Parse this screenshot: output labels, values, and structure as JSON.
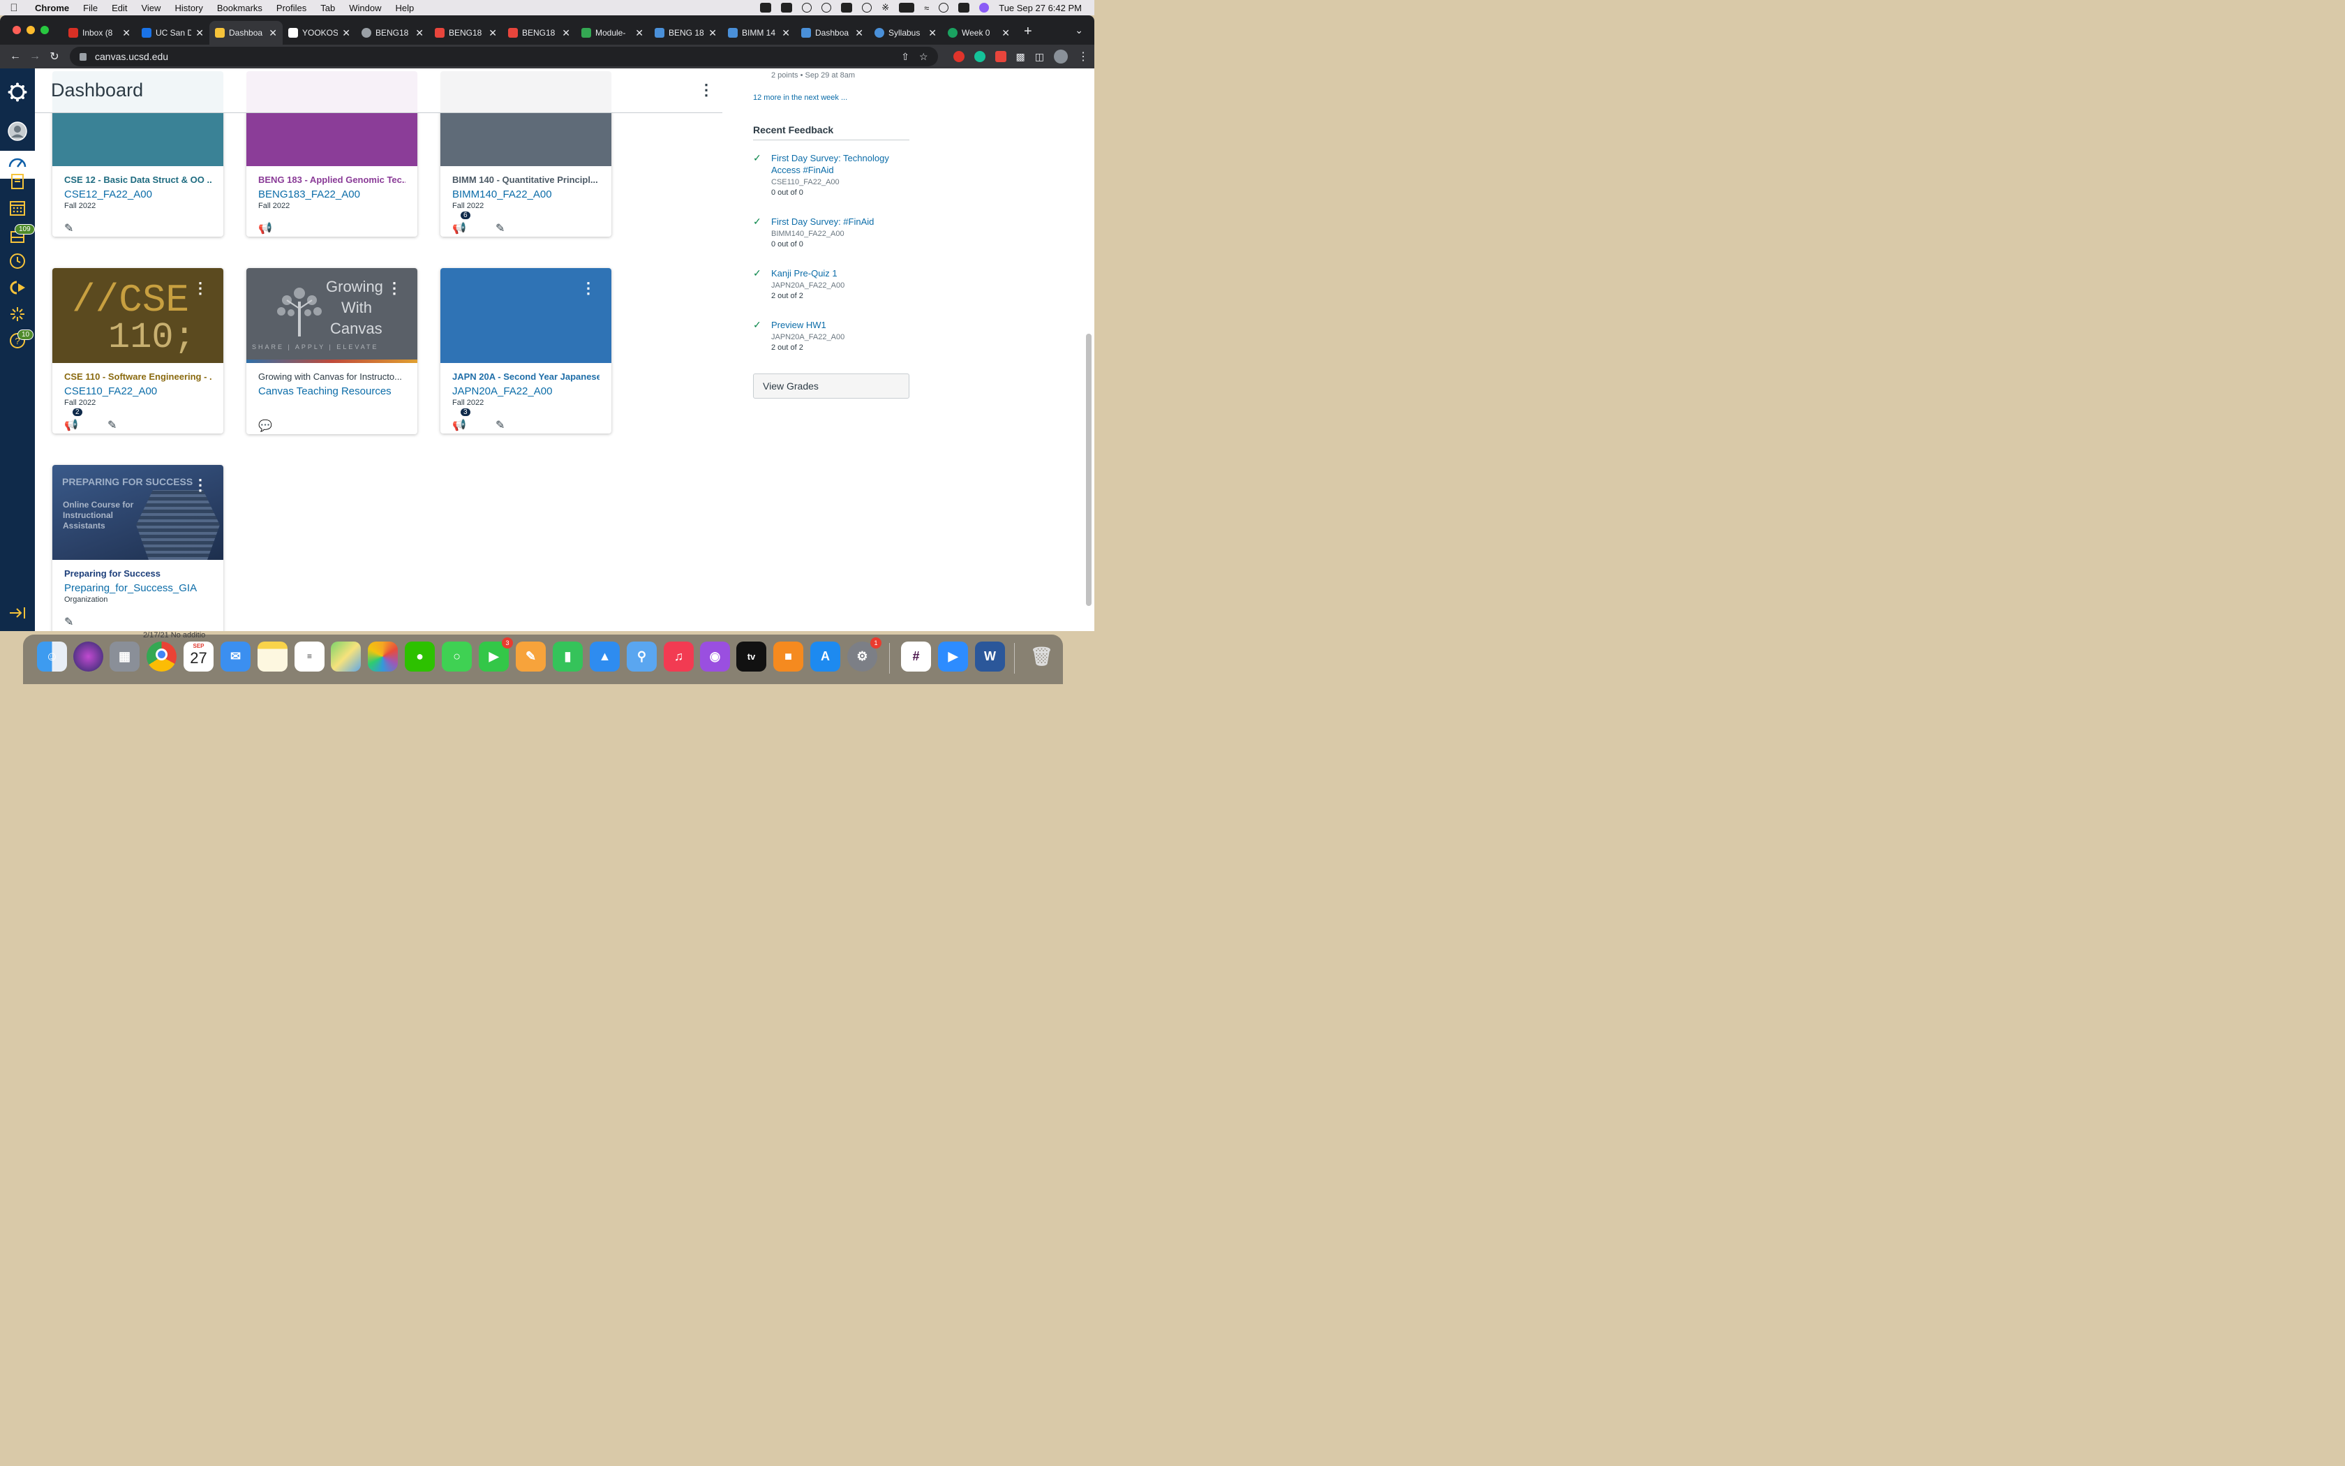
{
  "menubar": {
    "app": "Chrome",
    "items": [
      "File",
      "Edit",
      "View",
      "History",
      "Bookmarks",
      "Profiles",
      "Tab",
      "Window",
      "Help"
    ],
    "datetime": "Tue Sep 27  6:42 PM"
  },
  "tabs": [
    {
      "title": "Inbox (8",
      "color": "#d93025"
    },
    {
      "title": "UC San D",
      "color": "#1a73e8"
    },
    {
      "title": "Dashboa",
      "color": "#f6c33a"
    },
    {
      "title": "YOOKOS",
      "color": "#ffffff"
    },
    {
      "title": "BENG18",
      "color": "#9aa0a6"
    },
    {
      "title": "BENG18",
      "color": "#e8453c"
    },
    {
      "title": "BENG18",
      "color": "#e8453c"
    },
    {
      "title": "Module-",
      "color": "#34a853"
    },
    {
      "title": "BENG 18",
      "color": "#4a90d9"
    },
    {
      "title": "BIMM 14",
      "color": "#4a90d9"
    },
    {
      "title": "Dashboa",
      "color": "#4a90d9"
    },
    {
      "title": "Syllabus",
      "color": "#4a90d9"
    },
    {
      "title": "Week 0",
      "color": "#1aa260"
    }
  ],
  "url": "canvas.ucsd.edu",
  "dashboard": {
    "title": "Dashboard"
  },
  "nav": {
    "badges": {
      "inbox": "109",
      "help": "10"
    }
  },
  "cards": [
    {
      "title": "CSE 12 - Basic Data Struct & OO ...",
      "code": "CSE12_FA22_A00",
      "term": "Fall 2022",
      "title_color": "#1e6b80",
      "hero": "#3a8296"
    },
    {
      "title": "BENG 183 - Applied Genomic Tec...",
      "code": "BENG183_FA22_A00",
      "term": "Fall 2022",
      "title_color": "#8a3b97",
      "hero": "#8b3d98"
    },
    {
      "title": "BIMM 140 - Quantitative Principl...",
      "code": "BIMM140_FA22_A00",
      "term": "Fall 2022",
      "title_color": "#4c5a66",
      "hero": "#5f6b78",
      "badge": "6"
    },
    {
      "title": "CSE 110 - Software Engineering - ...",
      "code": "CSE110_FA22_A00",
      "term": "Fall 2022",
      "title_color": "#8a6a10",
      "hero_text_1": "//CSE",
      "hero_text_2": "110;",
      "badge": "2"
    },
    {
      "title": "Growing with Canvas for Instructo...",
      "code": "Canvas Teaching Resources",
      "term": "",
      "title_color": "#2d3b45",
      "hero_text_1": "Growing",
      "hero_text_2": "With",
      "hero_text_3": "Canvas",
      "hero_text_4": "SHARE | APPLY | ELEVATE"
    },
    {
      "title": "JAPN 20A - Second Year Japanese ...",
      "code": "JAPN20A_FA22_A00",
      "term": "Fall 2022",
      "title_color": "#1f6ea8",
      "hero": "#2f73b5",
      "badge": "3"
    },
    {
      "title": "Preparing for Success",
      "code": "Preparing_for_Success_GIA",
      "term": "Organization",
      "title_color": "#1d3f7a",
      "hero_text_1": "PREPARING FOR SUCCESS",
      "hero_text_2": "Online Course for",
      "hero_text_3": "Instructional",
      "hero_text_4": "Assistants"
    }
  ],
  "sidebar": {
    "todo_meta": "2 points • Sep 29 at 8am",
    "more_link": "12 more in the next week ...",
    "feedback_heading": "Recent Feedback",
    "feedback": [
      {
        "title": "First Day Survey: Technology Access #FinAid",
        "course": "CSE110_FA22_A00",
        "score": "0 out of 0"
      },
      {
        "title": "First Day Survey: #FinAid",
        "course": "BIMM140_FA22_A00",
        "score": "0 out of 0"
      },
      {
        "title": "Kanji Pre-Quiz 1",
        "course": "JAPN20A_FA22_A00",
        "score": "2 out of 2"
      },
      {
        "title": "Preview HW1",
        "course": "JAPN20A_FA22_A00",
        "score": "2 out of 2"
      }
    ],
    "view_grades": "View Grades"
  },
  "dock": {
    "calendar_month": "SEP",
    "calendar_day": "27",
    "facetime_badge": "3",
    "settings_badge": "1",
    "peek_text": "2/17/21 No additio"
  }
}
